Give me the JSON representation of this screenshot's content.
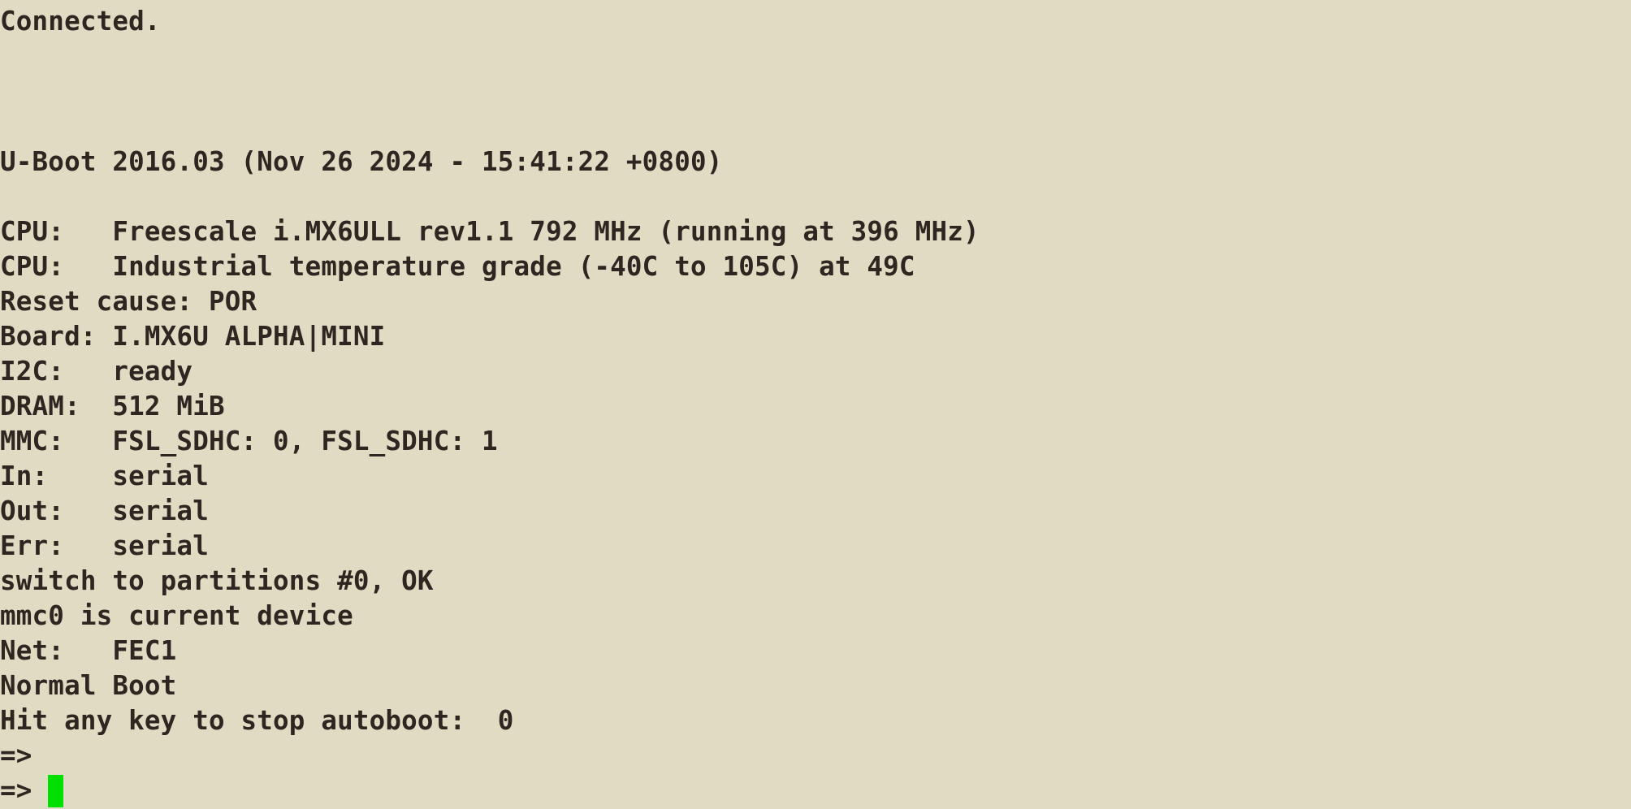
{
  "terminal": {
    "lines": [
      "Connected.",
      "U-Boot 2016.03 (Nov 26 2024 - 15:41:22 +0800)",
      "CPU:   Freescale i.MX6ULL rev1.1 792 MHz (running at 396 MHz)",
      "CPU:   Industrial temperature grade (-40C to 105C) at 49C",
      "Reset cause: POR",
      "Board: I.MX6U ALPHA|MINI",
      "I2C:   ready",
      "DRAM:  512 MiB",
      "MMC:   FSL_SDHC: 0, FSL_SDHC: 1",
      "In:    serial",
      "Out:   serial",
      "Err:   serial",
      "switch to partitions #0, OK",
      "mmc0 is current device",
      "Net:   FEC1",
      "Normal Boot",
      "Hit any key to stop autoboot:  0",
      "=>",
      "=> "
    ],
    "colors": {
      "background": "#e0dbc3",
      "text": "#2e2620",
      "cursor": "#00e000"
    }
  }
}
